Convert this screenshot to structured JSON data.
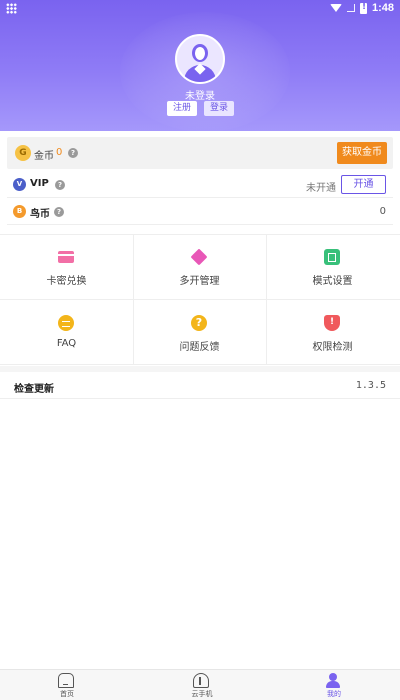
{
  "status_bar": {
    "time": "1:48"
  },
  "profile": {
    "username": "未登录",
    "register_label": "注册",
    "login_label": "登录"
  },
  "coin": {
    "icon_letter": "G",
    "label": "金币",
    "value": "0",
    "help": "?",
    "get_button": "获取金币"
  },
  "vip": {
    "label": "VIP",
    "help": "?",
    "status": "未开通",
    "open_button": "开通"
  },
  "bird_coin": {
    "icon_letter": "B",
    "label": "鸟币",
    "help": "?",
    "value": "0"
  },
  "grid": {
    "items": [
      {
        "label": "卡密兑换",
        "icon": "card-icon"
      },
      {
        "label": "多开管理",
        "icon": "layers-icon"
      },
      {
        "label": "模式设置",
        "icon": "mode-icon"
      },
      {
        "label": "FAQ",
        "icon": "faq-icon"
      },
      {
        "label": "问题反馈",
        "icon": "question-icon",
        "glyph": "?"
      },
      {
        "label": "权限检测",
        "icon": "shield-icon",
        "glyph": "!"
      }
    ]
  },
  "update": {
    "label": "检查更新",
    "version": "1.3.5"
  },
  "bottom_nav": {
    "items": [
      {
        "label": "首页",
        "icon": "home-icon"
      },
      {
        "label": "云手机",
        "icon": "cloud-phone-icon"
      },
      {
        "label": "我的",
        "icon": "profile-icon",
        "active": true
      }
    ]
  },
  "colors": {
    "brand": "#7a63ef",
    "accent_orange": "#f08a1d"
  }
}
